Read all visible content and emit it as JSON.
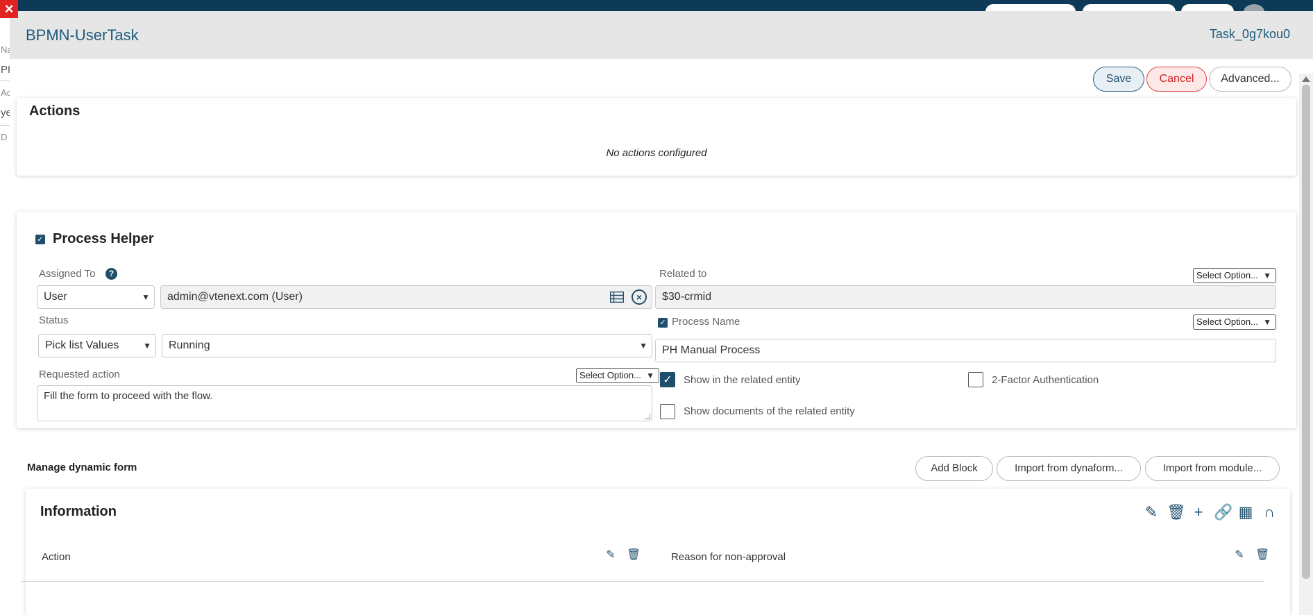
{
  "window": {
    "title": "BPMN-UserTask",
    "task_id": "Task_0g7kou0"
  },
  "background": {
    "side_letters": [
      "Na",
      "PH",
      "Ac",
      "ye",
      "D"
    ]
  },
  "toolbar": {
    "save_label": "Save",
    "cancel_label": "Cancel",
    "advanced_label": "Advanced..."
  },
  "actions": {
    "title": "Actions",
    "empty_text": "No actions configured"
  },
  "process_helper": {
    "title": "Process Helper",
    "assigned_to": {
      "label": "Assigned To",
      "type_value": "User",
      "user_value": "admin@vtenext.com (User)"
    },
    "related_to": {
      "label": "Related to",
      "option_label": "Select Option...",
      "value": "$30-crmid"
    },
    "status": {
      "label": "Status",
      "type_value": "Pick list Values",
      "value": "Running"
    },
    "process_name": {
      "label": "Process Name",
      "option_label": "Select Option...",
      "value": "PH Manual Process"
    },
    "requested_action": {
      "label": "Requested action",
      "option_label": "Select Option...",
      "value": "Fill the form to proceed with the flow."
    },
    "show_related_label": "Show in the related entity",
    "two_factor_label": "2-Factor Authentication",
    "show_docs_label": "Show documents of the related entity"
  },
  "dynamic_form": {
    "title": "Manage dynamic form",
    "add_block_label": "Add Block",
    "import_dynaform_label": "Import from dynaform...",
    "import_module_label": "Import from module..."
  },
  "information": {
    "title": "Information",
    "fields": [
      "Action",
      "Reason for non-approval"
    ]
  },
  "colors": {
    "accent": "#1d4e6b",
    "header_bg": "#e6e6e6",
    "cancel_red": "#d02020"
  }
}
